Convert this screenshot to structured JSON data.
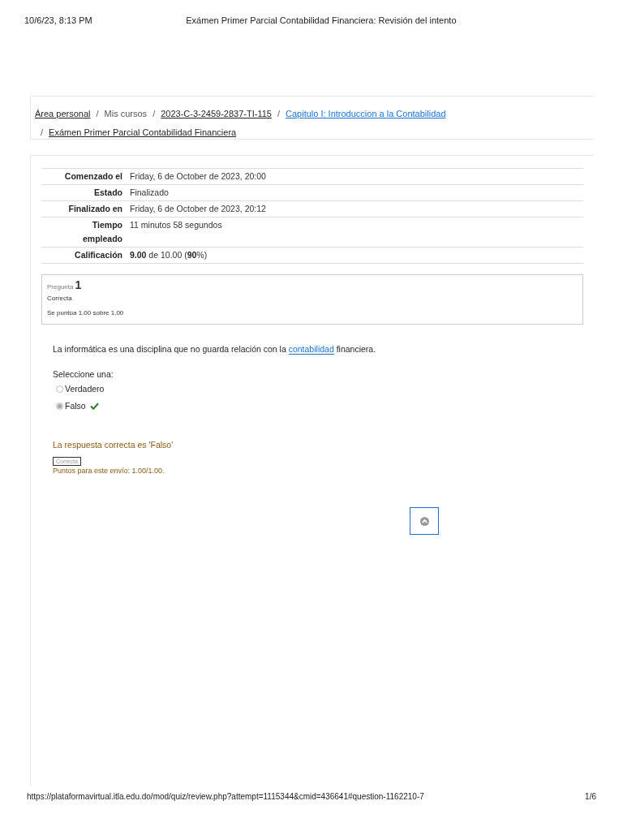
{
  "print_header": {
    "date": "10/6/23, 8:13 PM",
    "title": "Exámen Primer Parcial Contabilidad Financiera: Revisión del intento"
  },
  "breadcrumb": [
    {
      "label": "Área personal",
      "kind": "link"
    },
    {
      "separator": "/",
      "label": "Mis cursos",
      "kind": "text"
    },
    {
      "separator": "/",
      "label": "2023-C-3-2459-2837-TI-115",
      "kind": "link"
    },
    {
      "separator": "/",
      "label": "Capitulo I: Introduccion a la Contabilidad",
      "kind": "accent"
    },
    {
      "separator": "/",
      "label": "Exámen Primer Parcial Contabilidad Financiera",
      "kind": "link",
      "new_line": true
    }
  ],
  "summary": [
    {
      "label": "Comenzado el",
      "value": "Friday, 6 de October de 2023, 20:00"
    },
    {
      "label": "Estado",
      "value": "Finalizado"
    },
    {
      "label": "Finalizado en",
      "value": "Friday, 6 de October de 2023, 20:12"
    },
    {
      "label": "Tiempo empleado",
      "value": "11 minutos 58 segundos"
    },
    {
      "label": "Calificación",
      "value": "**9.00** de 10.00 (**90**%)"
    }
  ],
  "question": {
    "prefix": "Pregunta",
    "number": "1",
    "status": "Correcta",
    "score": "Se puntúa 1.00 sobre 1.00",
    "text_before": "La informática es una disciplina que no guarda relación con la",
    "link": "contabilidad",
    "text_after": "financiera.",
    "prompt": "Seleccione una:",
    "options": [
      {
        "label": "Verdadero",
        "selected": false,
        "correct": false
      },
      {
        "label": "Falso",
        "selected": true,
        "correct": true
      }
    ],
    "right_answer": "La respuesta correcta es 'Falso'",
    "badge": "Correcta",
    "points": "Puntos para este envío: 1.00/1.00."
  },
  "footer": {
    "url": "https://plataformavirtual.itla.edu.do/mod/quiz/review.php?attempt=1115344&cmid=436641#question-1162210-7",
    "page": "1/6"
  }
}
